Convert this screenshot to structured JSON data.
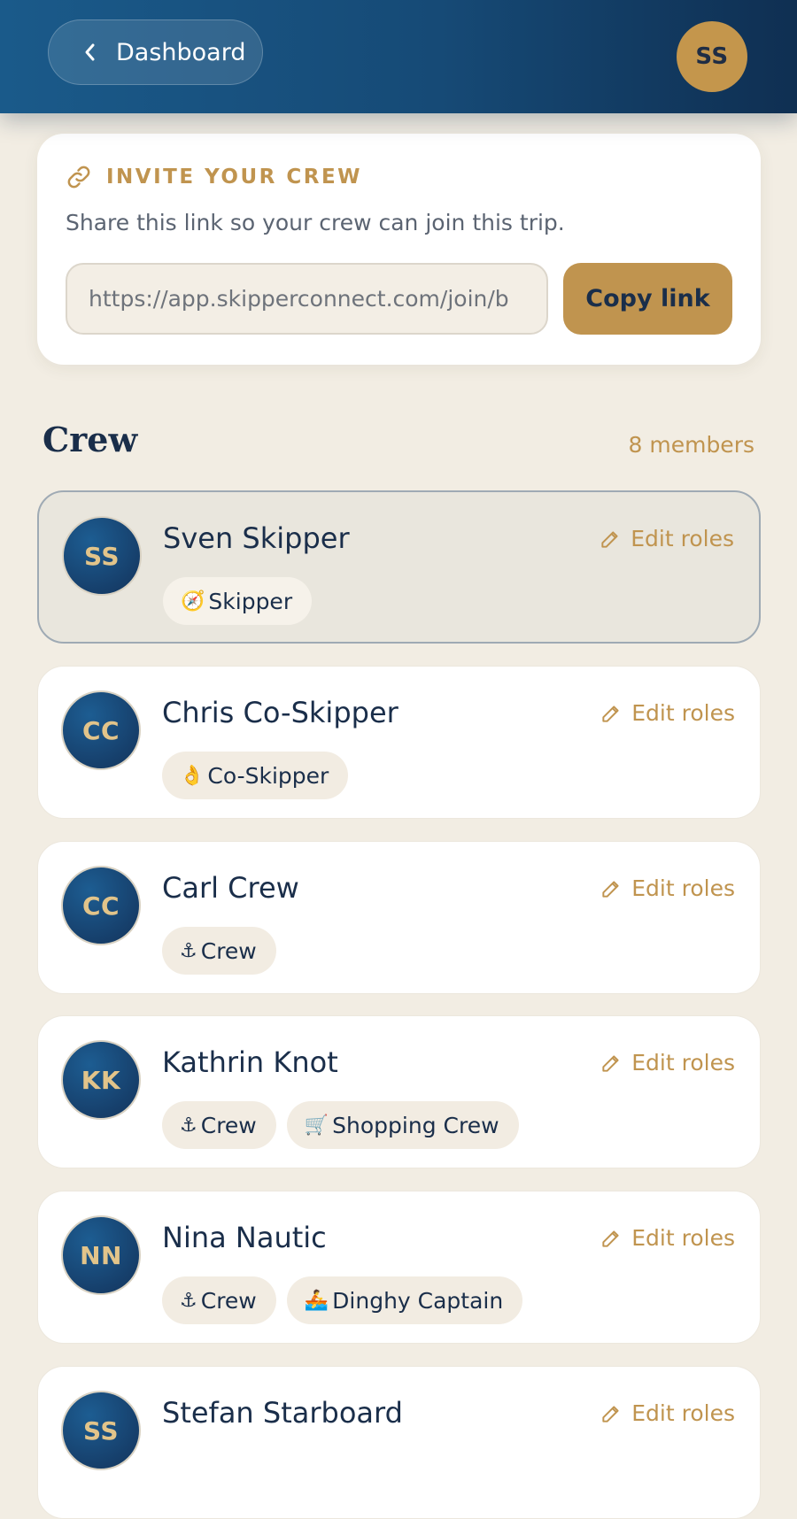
{
  "header": {
    "back_label": "Dashboard",
    "user_initials": "SS"
  },
  "invite": {
    "title": "INVITE YOUR CREW",
    "subtitle": "Share this link so your crew can join this trip.",
    "link_value": "https://app.skipperconnect.com/join/b",
    "copy_label": "Copy link"
  },
  "crew": {
    "title": "Crew",
    "count_label": "8 members",
    "edit_label": "Edit roles",
    "members": [
      {
        "initials": "SS",
        "name": "Sven Skipper",
        "current": true,
        "roles": [
          {
            "emoji": "🧭",
            "label": "Skipper"
          }
        ]
      },
      {
        "initials": "CC",
        "name": "Chris Co-Skipper",
        "roles": [
          {
            "emoji": "👌",
            "label": "Co-Skipper"
          }
        ]
      },
      {
        "initials": "CC",
        "name": "Carl Crew",
        "roles": [
          {
            "emoji": "⚓",
            "label": "Crew"
          }
        ]
      },
      {
        "initials": "KK",
        "name": "Kathrin Knot",
        "roles": [
          {
            "emoji": "⚓",
            "label": "Crew"
          },
          {
            "emoji": "🛒",
            "label": "Shopping Crew"
          }
        ]
      },
      {
        "initials": "NN",
        "name": "Nina Nautic",
        "roles": [
          {
            "emoji": "⚓",
            "label": "Crew"
          },
          {
            "emoji": "🚣",
            "label": "Dinghy Captain"
          }
        ]
      },
      {
        "initials": "SS",
        "name": "Stefan Starboard",
        "roles": []
      }
    ]
  },
  "colors": {
    "brand_navy": "#1a2e4a",
    "accent_gold": "#c0944f",
    "page_bg": "#f2ede3"
  }
}
